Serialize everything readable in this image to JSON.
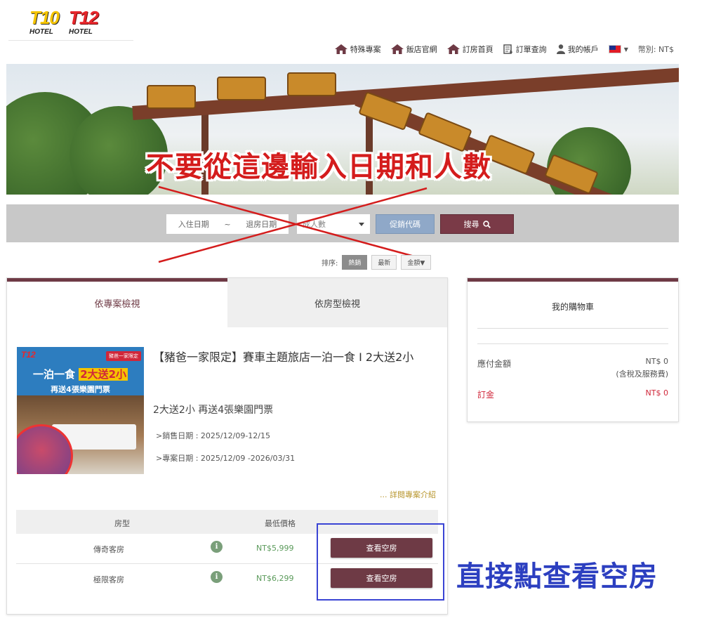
{
  "logo": {
    "word1": "T10",
    "word2": "T12",
    "sub1": "HOTEL",
    "sub2": "HOTEL"
  },
  "nav": {
    "items": [
      "特殊專案",
      "飯店官網",
      "訂房首頁",
      "訂單查詢",
      "我的帳戶"
    ],
    "currency": "幣別: NT$",
    "accent": "#6e3a45"
  },
  "banner": {
    "annotation": "不要從這邊輸入日期和人數"
  },
  "search": {
    "checkin_placeholder": "入住日期",
    "separator": "~",
    "checkout_placeholder": "退房日期",
    "guests_placeholder": "成人數",
    "promo_label": "促銷代碼",
    "search_label": "搜尋"
  },
  "sort": {
    "label": "排序:",
    "options": [
      "熱銷",
      "最新",
      "金額▼"
    ]
  },
  "tabs": [
    "依專案檢視",
    "依房型檢視"
  ],
  "package": {
    "image": {
      "badge": "豬爸一家限定",
      "logo": "T12",
      "headline_a": "一泊一食",
      "headline_b": "2大送2小",
      "subline": "再送4張樂園門票"
    },
    "title": "【豬爸一家限定】賽車主題旅店一泊一食 I 2大送2小",
    "subtitle": "2大送2小 再送4張樂園門票",
    "sale_date": ">銷售日期 : 2025/12/09-12/15",
    "stay_date": ">專案日期 :  2025/12/09 -2026/03/31",
    "more_link": "... 詳閱專案介紹"
  },
  "room_table": {
    "headers": [
      "房型",
      "最低價格"
    ],
    "rows": [
      {
        "name": "傳奇客房",
        "price": "NT$5,999",
        "button": "查看空房"
      },
      {
        "name": "極限客房",
        "price": "NT$6,299",
        "button": "查看空房"
      }
    ],
    "annotation": "直接點查看空房"
  },
  "cart": {
    "title": "我的購物車",
    "total_label": "應付金額",
    "total_value": "NT$ 0",
    "total_note": "(含稅及服務費)",
    "deposit_label": "訂金",
    "deposit_value": "NT$ 0"
  }
}
